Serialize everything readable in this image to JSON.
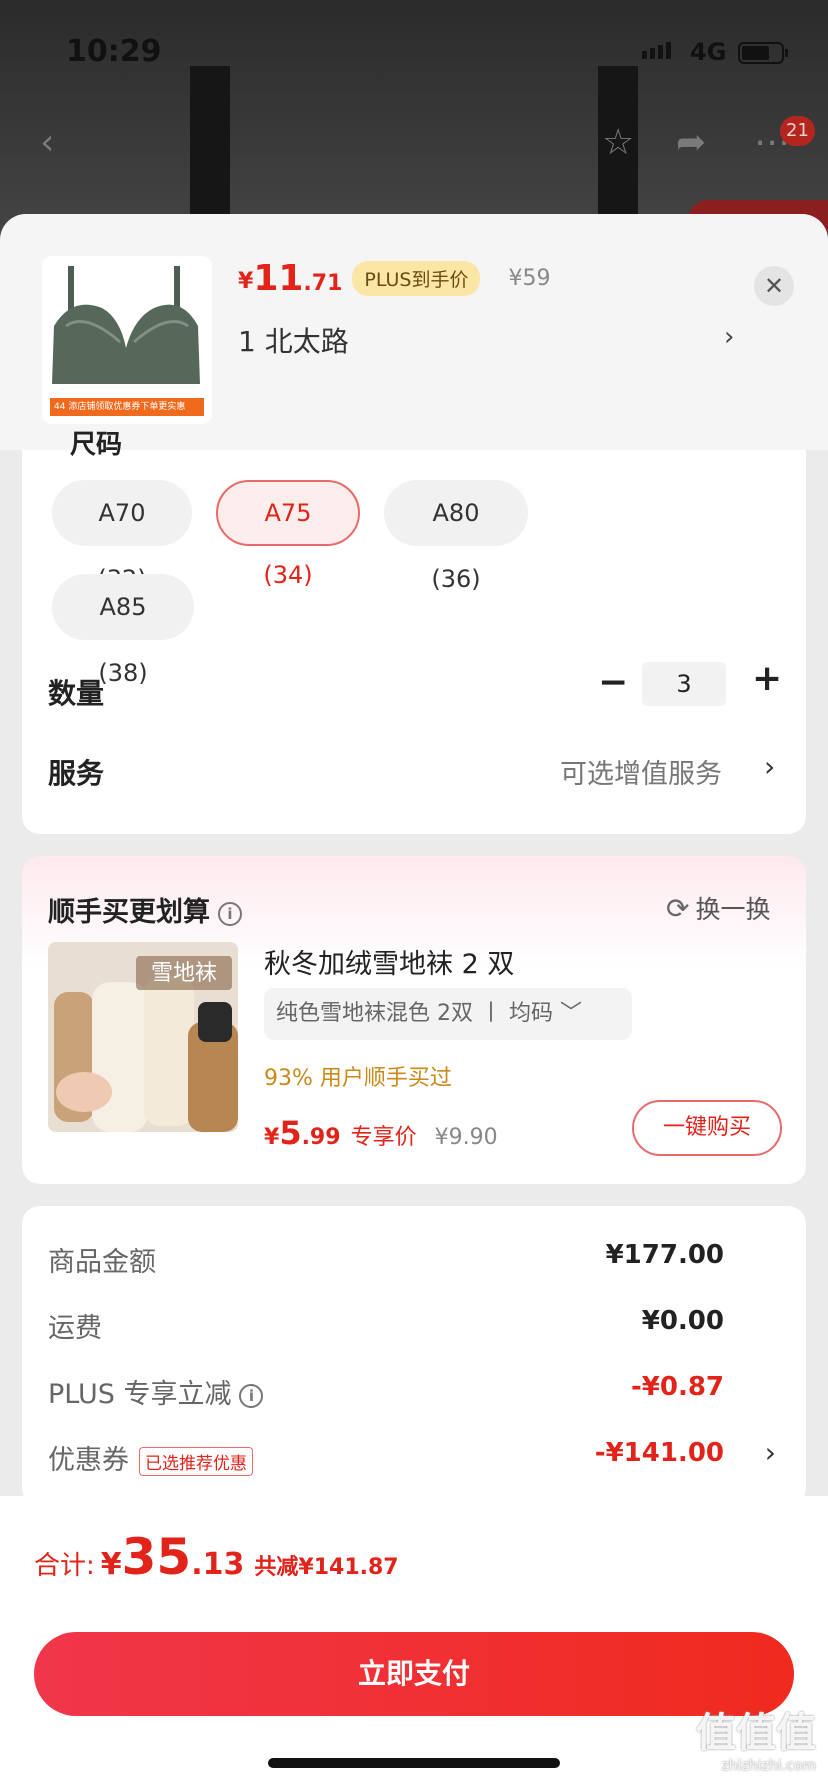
{
  "status": {
    "time": "10:29",
    "network": "4G"
  },
  "nav": {
    "cart_count": "21"
  },
  "product": {
    "price_symbol": "¥",
    "price_int": "11",
    "price_dec": ".71",
    "plus_tag": "PLUS到手价",
    "original_price": "¥59",
    "variant": "1  北太路",
    "thumb_banner": "44  添店铺领取优惠券下单更实惠"
  },
  "sizes": {
    "label": "尺码",
    "options": [
      "A70 (32)",
      "A75 (34)",
      "A80 (36)",
      "A85 (38)"
    ],
    "selected": "A75 (34)"
  },
  "quantity": {
    "label": "数量",
    "value": "3",
    "minus": "−",
    "plus": "+"
  },
  "service": {
    "label": "服务",
    "value": "可选增值服务",
    "chevron": "›"
  },
  "bundle": {
    "title": "顺手买更划算",
    "refresh": "换一换",
    "image_caption": "雪地袜",
    "name": "秋冬加绒雪地袜 2 双",
    "option": "纯色雪地袜混色 2双  丨  均码 ﹀",
    "sold": "93% 用户顺手买过",
    "price_symbol": "¥",
    "price_int": "5",
    "price_dec": ".99",
    "price_tag": "专享价",
    "original_price": "¥9.90",
    "buy_label": "一键购买"
  },
  "summary": {
    "rows": [
      {
        "label": "商品金额",
        "value": "¥177.00"
      },
      {
        "label": "运费",
        "value": "¥0.00"
      },
      {
        "label": "PLUS 专享立减",
        "value": "-¥0.87"
      },
      {
        "label": "优惠券",
        "tag": "已选推荐优惠",
        "value": "-¥141.00"
      }
    ]
  },
  "footer": {
    "total_label": "合计:",
    "total_symbol": "¥",
    "total_int": "35",
    "total_dec": ".13",
    "total_saved": "共减¥141.87",
    "pay_label": "立即支付"
  },
  "watermark": {
    "text": "值值值",
    "sub": "zhizhizhi.com"
  },
  "colors": {
    "accent": "#e2231a",
    "plus_tag_bg": "#fbe6a6",
    "pay_button": "#f02a1e"
  }
}
